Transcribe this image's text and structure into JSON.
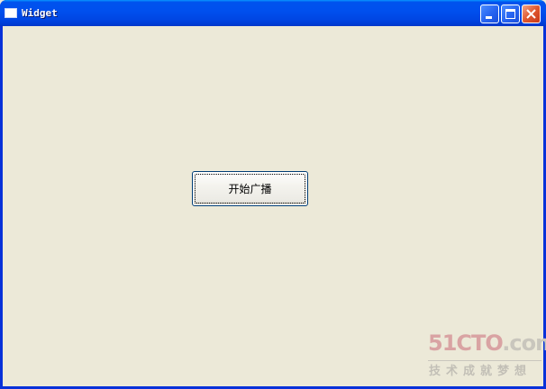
{
  "window": {
    "title": "Widget"
  },
  "main": {
    "start_broadcast_label": "开始广播"
  },
  "watermark": {
    "logo_main": "51CTO",
    "logo_suffix": ".com",
    "slogan": "技术成就梦想"
  },
  "colors": {
    "titlebar": "#0050ee",
    "client_background": "#ece9d8",
    "close_button": "#e0582e",
    "watermark_logo": "#d9a3a3"
  },
  "icons": {
    "title": "window-icon",
    "minimize": "minimize-icon",
    "maximize": "maximize-icon",
    "close": "close-icon"
  }
}
